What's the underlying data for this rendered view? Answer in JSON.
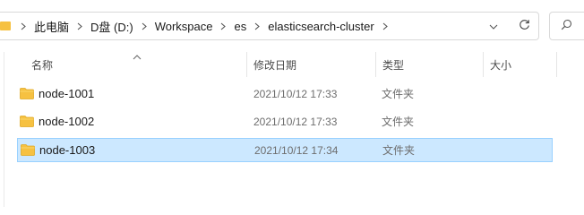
{
  "address_bar": {
    "breadcrumbs": [
      "此电脑",
      "D盘 (D:)",
      "Workspace",
      "es",
      "elasticsearch-cluster"
    ]
  },
  "columns": {
    "name": "名称",
    "modified": "修改日期",
    "type": "类型",
    "size": "大小"
  },
  "files": [
    {
      "name": "node-1001",
      "modified": "2021/10/12 17:33",
      "type": "文件夹",
      "size": ""
    },
    {
      "name": "node-1002",
      "modified": "2021/10/12 17:33",
      "type": "文件夹",
      "size": ""
    },
    {
      "name": "node-1003",
      "modified": "2021/10/12 17:34",
      "type": "文件夹",
      "size": ""
    }
  ],
  "selected_index": 2,
  "colors": {
    "folder": "#f6c141",
    "selection_bg": "#cce8ff",
    "selection_border": "#99d1ff"
  },
  "icons": {
    "breadcrumb_separator": "chevron-right-icon",
    "history": "chevron-down-icon",
    "refresh": "refresh-icon",
    "search": "search-icon",
    "sort": "sort-ascending-icon",
    "item": "folder-icon"
  }
}
